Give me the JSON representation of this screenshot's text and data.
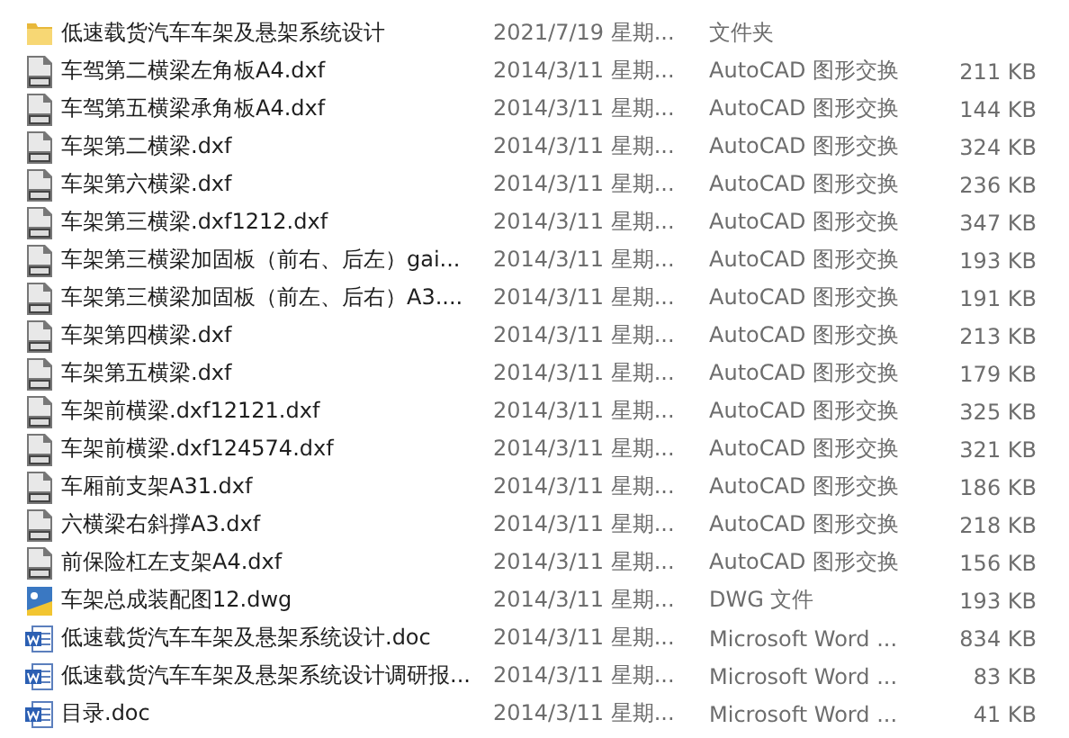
{
  "files": [
    {
      "kind": "folder",
      "name": "低速载货汽车车架及悬架系统设计",
      "modified": "2021/7/19 星期...",
      "type": "文件夹"
    },
    {
      "kind": "dxf",
      "name": "车驾第二横梁左角板A4.dxf",
      "modified": "2014/3/11 星期...",
      "type": "AutoCAD 图形交换",
      "size": "211 KB"
    },
    {
      "kind": "dxf",
      "name": "车驾第五横梁承角板A4.dxf",
      "modified": "2014/3/11 星期...",
      "type": "AutoCAD 图形交换",
      "size": "144 KB"
    },
    {
      "kind": "dxf",
      "name": "车架第二横梁.dxf",
      "modified": "2014/3/11 星期...",
      "type": "AutoCAD 图形交换",
      "size": "324 KB"
    },
    {
      "kind": "dxf",
      "name": "车架第六横梁.dxf",
      "modified": "2014/3/11 星期...",
      "type": "AutoCAD 图形交换",
      "size": "236 KB"
    },
    {
      "kind": "dxf",
      "name": "车架第三横梁.dxf1212.dxf",
      "modified": "2014/3/11 星期...",
      "type": "AutoCAD 图形交换",
      "size": "347 KB"
    },
    {
      "kind": "dxf",
      "name": "车架第三横梁加固板（前右、后左）gai...",
      "modified": "2014/3/11 星期...",
      "type": "AutoCAD 图形交换",
      "size": "193 KB"
    },
    {
      "kind": "dxf",
      "name": "车架第三横梁加固板（前左、后右）A3....",
      "modified": "2014/3/11 星期...",
      "type": "AutoCAD 图形交换",
      "size": "191 KB"
    },
    {
      "kind": "dxf",
      "name": "车架第四横梁.dxf",
      "modified": "2014/3/11 星期...",
      "type": "AutoCAD 图形交换",
      "size": "213 KB"
    },
    {
      "kind": "dxf",
      "name": "车架第五横梁.dxf",
      "modified": "2014/3/11 星期...",
      "type": "AutoCAD 图形交换",
      "size": "179 KB"
    },
    {
      "kind": "dxf",
      "name": "车架前横梁.dxf12121.dxf",
      "modified": "2014/3/11 星期...",
      "type": "AutoCAD 图形交换",
      "size": "325 KB"
    },
    {
      "kind": "dxf",
      "name": "车架前横梁.dxf124574.dxf",
      "modified": "2014/3/11 星期...",
      "type": "AutoCAD 图形交换",
      "size": "321 KB"
    },
    {
      "kind": "dxf",
      "name": "车厢前支架A31.dxf",
      "modified": "2014/3/11 星期...",
      "type": "AutoCAD 图形交换",
      "size": "186 KB"
    },
    {
      "kind": "dxf",
      "name": "六横梁右斜撑A3.dxf",
      "modified": "2014/3/11 星期...",
      "type": "AutoCAD 图形交换",
      "size": "218 KB"
    },
    {
      "kind": "dxf",
      "name": "前保险杠左支架A4.dxf",
      "modified": "2014/3/11 星期...",
      "type": "AutoCAD 图形交换",
      "size": "156 KB"
    },
    {
      "kind": "dwg",
      "name": "车架总成装配图12.dwg",
      "modified": "2014/3/11 星期...",
      "type": "DWG 文件",
      "size": "193 KB"
    },
    {
      "kind": "doc",
      "name": "低速载货汽车车架及悬架系统设计.doc",
      "modified": "2014/3/11 星期...",
      "type": "Microsoft Word ...",
      "size": "834 KB"
    },
    {
      "kind": "doc",
      "name": "低速载货汽车车架及悬架系统设计调研报...",
      "modified": "2014/3/11 星期...",
      "type": "Microsoft Word ...",
      "size": "83 KB"
    },
    {
      "kind": "doc",
      "name": "目录.doc",
      "modified": "2014/3/11 星期...",
      "type": "Microsoft Word ...",
      "size": "41 KB"
    }
  ]
}
